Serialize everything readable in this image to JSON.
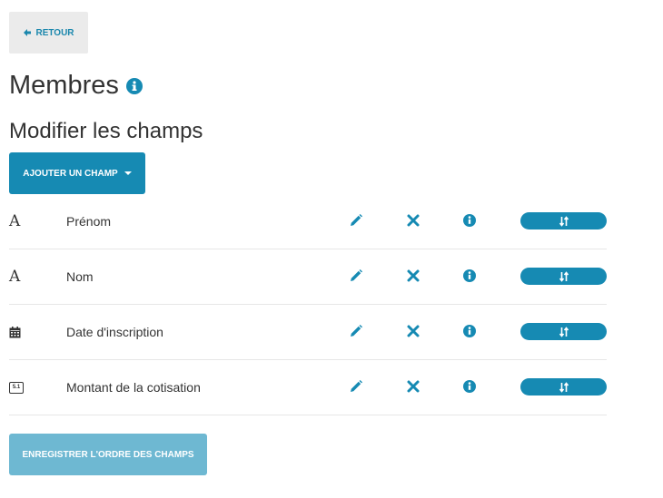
{
  "back": {
    "label": "RETOUR"
  },
  "page": {
    "title": "Membres",
    "subtitle": "Modifier les champs"
  },
  "add_button": {
    "label": "AJOUTER UN CHAMP"
  },
  "fields": [
    {
      "label": "Prénom",
      "type_icon": "text-A-icon",
      "type_glyph": "A"
    },
    {
      "label": "Nom",
      "type_icon": "text-A-icon",
      "type_glyph": "A"
    },
    {
      "label": "Date d'inscription",
      "type_icon": "calendar-icon"
    },
    {
      "label": "Montant de la cotisation",
      "type_icon": "decimal-number-icon",
      "type_glyph": "5.1"
    }
  ],
  "save_button": {
    "label": "ENREGISTRER L'ORDRE DES CHAMPS"
  },
  "colors": {
    "accent": "#168ab3",
    "accent_light": "#6eb8d2",
    "back_bg": "#ebebeb",
    "text": "#333333"
  }
}
